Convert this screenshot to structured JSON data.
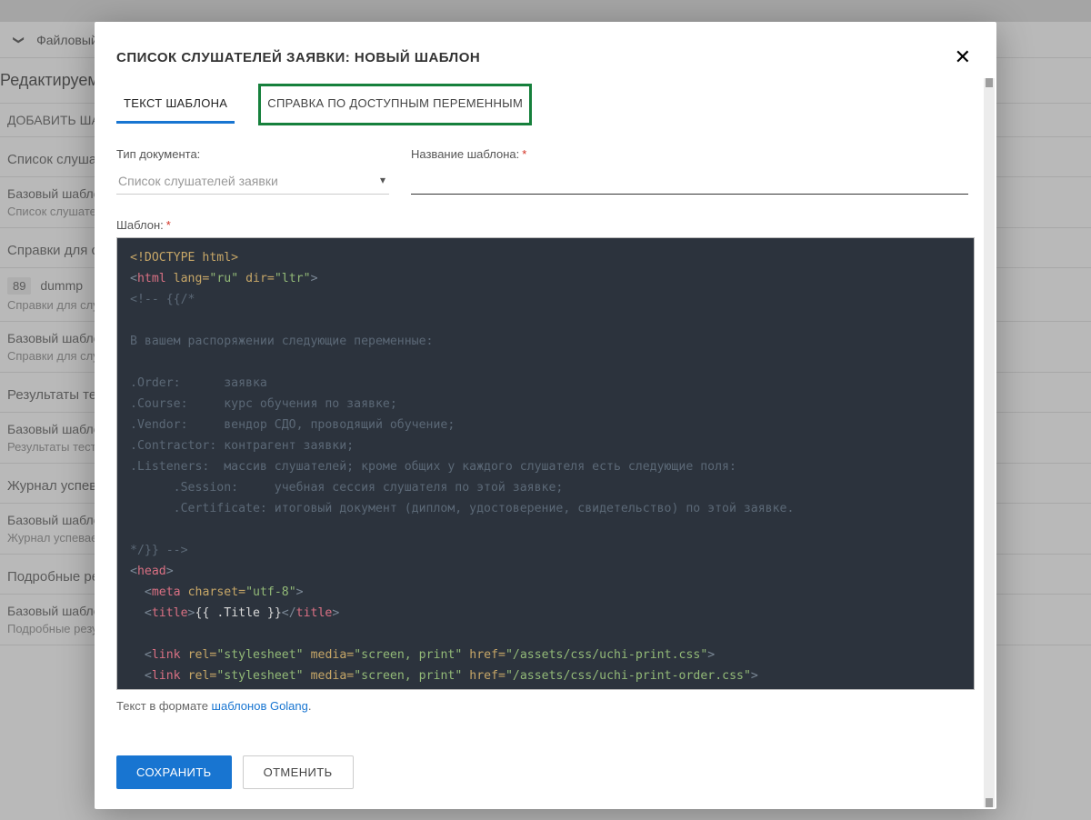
{
  "bg": {
    "file_menu": "Файловый менеджер",
    "editing": "Редактируемые документы",
    "add_btn": "ДОБАВИТЬ ШАБЛОН",
    "groups": [
      {
        "title": "Список слушателей заявки",
        "rows": [
          {
            "name": "Базовый шаблон",
            "sub": "Список слушателей заявки"
          }
        ]
      },
      {
        "title": "Справки для слушателей",
        "rows": [
          {
            "id": "89",
            "name": "dummp",
            "sub": "Справки для слушателей"
          },
          {
            "name": "Базовый шаблон",
            "sub": "Справки для слушателей"
          }
        ]
      },
      {
        "title": "Результаты тестирования",
        "rows": [
          {
            "name": "Базовый шаблон",
            "sub": "Результаты тестирования"
          }
        ]
      },
      {
        "title": "Журнал успеваемости",
        "rows": [
          {
            "name": "Базовый шаблон",
            "sub": "Журнал успеваемости"
          }
        ]
      },
      {
        "title": "Подробные результаты итогового задания",
        "rows": [
          {
            "name": "Базовый шаблон",
            "sub": "Подробные результаты итогового задания"
          }
        ]
      }
    ]
  },
  "modal": {
    "title": "СПИСОК СЛУШАТЕЛЕЙ ЗАЯВКИ: НОВЫЙ ШАБЛОН",
    "tabs": {
      "text": "ТЕКСТ ШАБЛОНА",
      "help": "СПРАВКА ПО ДОСТУПНЫМ ПЕРЕМЕННЫМ"
    },
    "doc_type_label": "Тип документа:",
    "doc_type_value": "Список слушателей заявки",
    "name_label": "Название шаблона:",
    "name_value": "",
    "template_label": "Шаблон:",
    "hint_pre": "Текст в формате ",
    "hint_link": "шаблонов Golang",
    "hint_post": ".",
    "save": "СОХРАНИТЬ",
    "cancel": "ОТМЕНИТЬ",
    "code": {
      "l1_doctype": "<!DOCTYPE html>",
      "l2": {
        "open": "<",
        "tag": "html",
        "a1": "lang=",
        "v1": "\"ru\"",
        "a2": "dir=",
        "v2": "\"ltr\"",
        "close": ">"
      },
      "l3": "<!-- {{/*",
      "l4": "",
      "l5": "В вашем распоряжении следующие переменные:",
      "l6": "",
      "l7": ".Order:      заявка",
      "l8": ".Course:     курс обучения по заявке;",
      "l9": ".Vendor:     вендор СДО, проводящий обучение;",
      "l10": ".Contractor: контрагент заявки;",
      "l11": ".Listeners:  массив слушателей; кроме общих у каждого слушателя есть следующие поля:",
      "l12": "      .Session:     учебная сессия слушателя по этой заявке;",
      "l13": "      .Certificate: итоговый документ (диплом, удостоверение, свидетельство) по этой заявке.",
      "l14": "",
      "l15": "*/}} -->",
      "l16": {
        "open": "<",
        "tag": "head",
        "close": ">"
      },
      "l17": {
        "indent": "  ",
        "open": "<",
        "tag": "meta",
        "a1": "charset=",
        "v1": "\"utf-8\"",
        "close": ">"
      },
      "l18": {
        "indent": "  ",
        "open": "<",
        "tag": "title",
        "close": ">",
        "expr": "{{ .Title }}",
        "open2": "</",
        "tag2": "title",
        "close2": ">"
      },
      "l19": "",
      "l20": {
        "indent": "  ",
        "open": "<",
        "tag": "link",
        "a1": "rel=",
        "v1": "\"stylesheet\"",
        "a2": "media=",
        "v2": "\"screen, print\"",
        "a3": "href=",
        "v3": "\"/assets/css/uchi-print.css\"",
        "close": ">"
      },
      "l21": {
        "indent": "  ",
        "open": "<",
        "tag": "link",
        "a1": "rel=",
        "v1": "\"stylesheet\"",
        "a2": "media=",
        "v2": "\"screen, print\"",
        "a3": "href=",
        "v3": "\"/assets/css/uchi-print-order.css\"",
        "close": ">"
      }
    }
  }
}
